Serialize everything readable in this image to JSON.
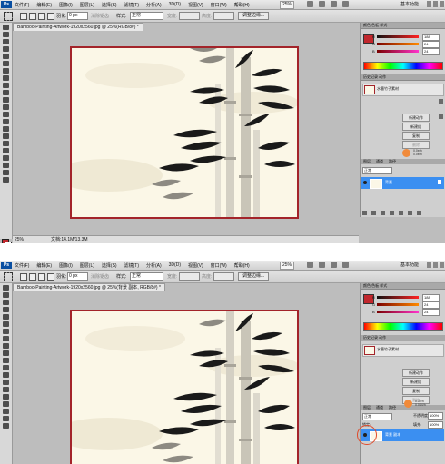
{
  "menu": [
    "文件(F)",
    "编辑(E)",
    "图像(I)",
    "图层(L)",
    "选择(S)",
    "滤镜(T)",
    "分析(A)",
    "3D(D)",
    "视图(V)",
    "窗口(W)",
    "帮助(H)"
  ],
  "app_logo": "Ps",
  "zoom_menu": "25%",
  "workspace": "基本功能",
  "options": {
    "feather_label": "羽化:",
    "feather_value": "0 px",
    "antialias_label": "消除锯齿",
    "style_label": "样式:",
    "style_value": "正常",
    "width_label": "宽度:",
    "height_label": "高度:",
    "refine_edge": "调整边缘..."
  },
  "top": {
    "doc_tab": "Bamboo-Painting-Artwork-1920x2560.jpg @ 25%(RGB/8#) *",
    "status_zoom": "25%",
    "status_doc": "文档:14.1M/13.3M",
    "highlight_text": [
      "0.0e/h",
      "0.0e/h"
    ],
    "layer_name": "背景"
  },
  "bottom": {
    "doc_tab": "Bamboo-Painting-Artwork-1920x2560.jpg @ 25%(背景 副本, RGB/8#) *",
    "layer_name": "背景 副本",
    "highlight_text": [
      "0.3e/h",
      "0.044/h"
    ],
    "opacity_value": "100%",
    "fill_value": "100%"
  },
  "color_panel": {
    "tabs": "颜色   色板   样式",
    "r_label": "R",
    "g_label": "G",
    "b_label": "B",
    "r": "188",
    "g": "24",
    "b": "24",
    "fg_color": "#c1272d"
  },
  "history_panel": {
    "tabs": "历史记录   动作",
    "item": "水墨竹子素材",
    "buttons": [
      "新建动作",
      "新建组",
      "复制",
      "删除"
    ]
  },
  "layers_panel": {
    "tabs": [
      "图层",
      "通道",
      "路径"
    ],
    "blend_mode": "正常",
    "opacity_label": "不透明度:",
    "opacity_value": "100%",
    "lock_label": "锁定:",
    "fill_label": "填充:",
    "fill_value": "100%"
  },
  "colors": {
    "frame_red": "#a3242a",
    "canvas_bg": "#fbf7e7",
    "layer_selected": "#3b8ff1",
    "highlight": "#e04a2a"
  }
}
